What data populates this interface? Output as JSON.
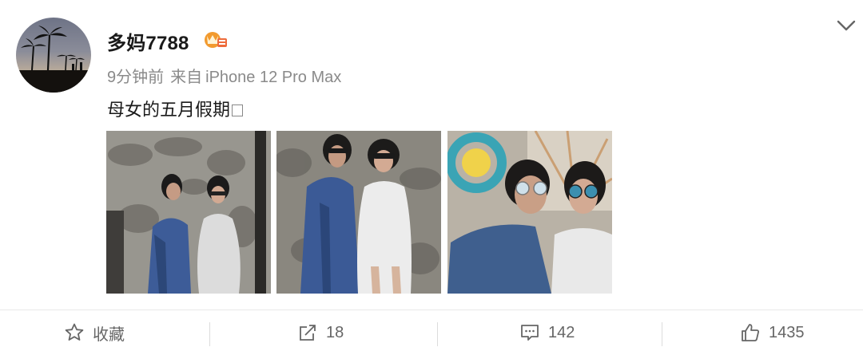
{
  "post": {
    "username": "多妈7788",
    "time": "9分钟前",
    "source_prefix": "来自",
    "source_device": "iPhone 12 Pro Max",
    "text": "母女的五月假期"
  },
  "icons": {
    "more": "chevron-down-icon",
    "badge": "vip-crown-icon",
    "favorite": "star-icon",
    "repost": "share-icon",
    "comment": "comment-icon",
    "like": "thumbs-up-icon"
  },
  "actions": {
    "favorite_label": "收藏",
    "repost_count": "18",
    "comment_count": "142",
    "like_count": "1435"
  },
  "photos": [
    {
      "alt": "mother-daughter-denim-wall"
    },
    {
      "alt": "mother-daughter-concrete-wall"
    },
    {
      "alt": "mother-daughter-umbrella-selfie"
    }
  ],
  "colors": {
    "text_primary": "#1a1a1a",
    "text_secondary": "#8a8a8a",
    "action_text": "#666666",
    "badge_orange": "#f29a2e"
  }
}
